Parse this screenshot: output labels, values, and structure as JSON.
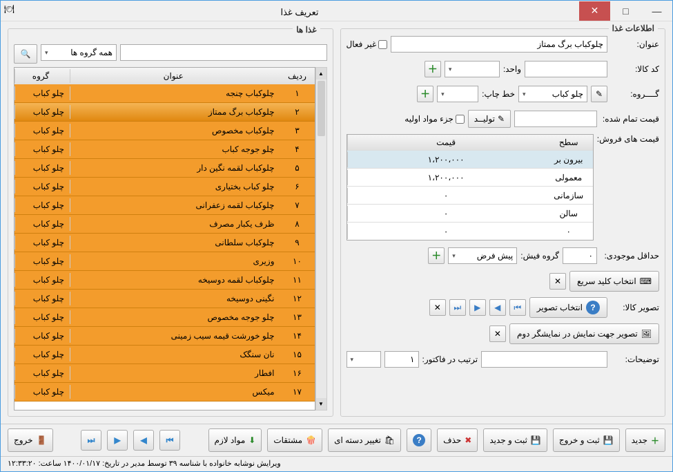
{
  "window_title": "تعریف غذا",
  "panel_right_title": "اطلاعات غذا",
  "panel_left_title": "غذا ها",
  "labels": {
    "title": "عنوان:",
    "inactive": "غیر فعال",
    "item_code": "کد کالا:",
    "unit": "واحد:",
    "group": "گــــروه:",
    "print_line": "خط چاپ:",
    "finished_price": "قیمت تمام شده:",
    "produce": "تولیــد",
    "raw_material": "جزء مواد اولیه",
    "sale_prices": "قیمت های فروش:",
    "min_stock": "حداقل موجودی:",
    "fish_group": "گروه فیش:",
    "quick_key": "انتخاب کلید سریع",
    "item_image": "تصویر کالا:",
    "select_image": "انتخاب تصویر",
    "second_display_image": "تصویر جهت نمایش در نمایشگر دوم",
    "description": "توضیحات:",
    "invoice_order": "ترتیب در فاکتور:",
    "all_groups": "همه گروه ها"
  },
  "form": {
    "title_value": "چلوکباب برگ ممتاز",
    "group_value": "چلو کباب",
    "fish_group_value": "پیش فرض",
    "min_stock_value": "٠",
    "invoice_order_value": "١"
  },
  "price_table": {
    "header_level": "سطح",
    "header_price": "قیمت",
    "rows": [
      {
        "level": "بیرون بر",
        "price": "١،٢٠٠،٠٠٠"
      },
      {
        "level": "معمولی",
        "price": "١،٢٠٠،٠٠٠"
      },
      {
        "level": "سازمانی",
        "price": "٠"
      },
      {
        "level": "سالن",
        "price": "٠"
      },
      {
        "level": "٠",
        "price": "٠"
      }
    ]
  },
  "food_table": {
    "header_idx": "ردیف",
    "header_name": "عنوان",
    "header_group": "گروه",
    "rows": [
      {
        "idx": "١",
        "name": "چلوکباب چنجه",
        "group": "چلو کباب"
      },
      {
        "idx": "٢",
        "name": "چلوکباب برگ ممتاز",
        "group": "چلو کباب"
      },
      {
        "idx": "٣",
        "name": "چلوکباب مخصوص",
        "group": "چلو کباب"
      },
      {
        "idx": "۴",
        "name": "چلو جوجه کباب",
        "group": "چلو کباب"
      },
      {
        "idx": "۵",
        "name": "چلوکباب لقمه نگین دار",
        "group": "چلو کباب"
      },
      {
        "idx": "۶",
        "name": "چلو کباب بختیاری",
        "group": "چلو کباب"
      },
      {
        "idx": "٧",
        "name": "چلوکباب لقمه زعفرانی",
        "group": "چلو کباب"
      },
      {
        "idx": "٨",
        "name": "ظرف یکبار مصرف",
        "group": "چلو کباب"
      },
      {
        "idx": "٩",
        "name": "چلوکباب سلطانی",
        "group": "چلو کباب"
      },
      {
        "idx": "١٠",
        "name": "وزیری",
        "group": "چلو کباب"
      },
      {
        "idx": "١١",
        "name": "چلوکباب لقمه دوسیخه",
        "group": "چلو کباب"
      },
      {
        "idx": "١٢",
        "name": "نگینی دوسیخه",
        "group": "چلو کباب"
      },
      {
        "idx": "١٣",
        "name": "چلو جوجه مخصوص",
        "group": "چلو کباب"
      },
      {
        "idx": "١۴",
        "name": "چلو خورشت قیمه سیب زمینی",
        "group": "چلو کباب"
      },
      {
        "idx": "١۵",
        "name": "نان سنگک",
        "group": "چلو کباب"
      },
      {
        "idx": "١۶",
        "name": "افطار",
        "group": "چلو کباب"
      },
      {
        "idx": "١٧",
        "name": "میکس",
        "group": "چلو کباب"
      }
    ]
  },
  "toolbar": {
    "new": "جدید",
    "save_exit": "ثبت و خروج",
    "save_new": "ثبت و جدید",
    "delete": "حذف",
    "batch_change": "تغییر دسته ای",
    "derivatives": "مشتقات",
    "materials": "مواد لازم",
    "exit": "خروج"
  },
  "statusbar": "ویرایش نوشابه خانواده با شناسه ٣٩ توسط مدیر در تاریخ: ١۴٠٠/٠١/١٧ ساعت: ١٢:٣٣:٢٠"
}
